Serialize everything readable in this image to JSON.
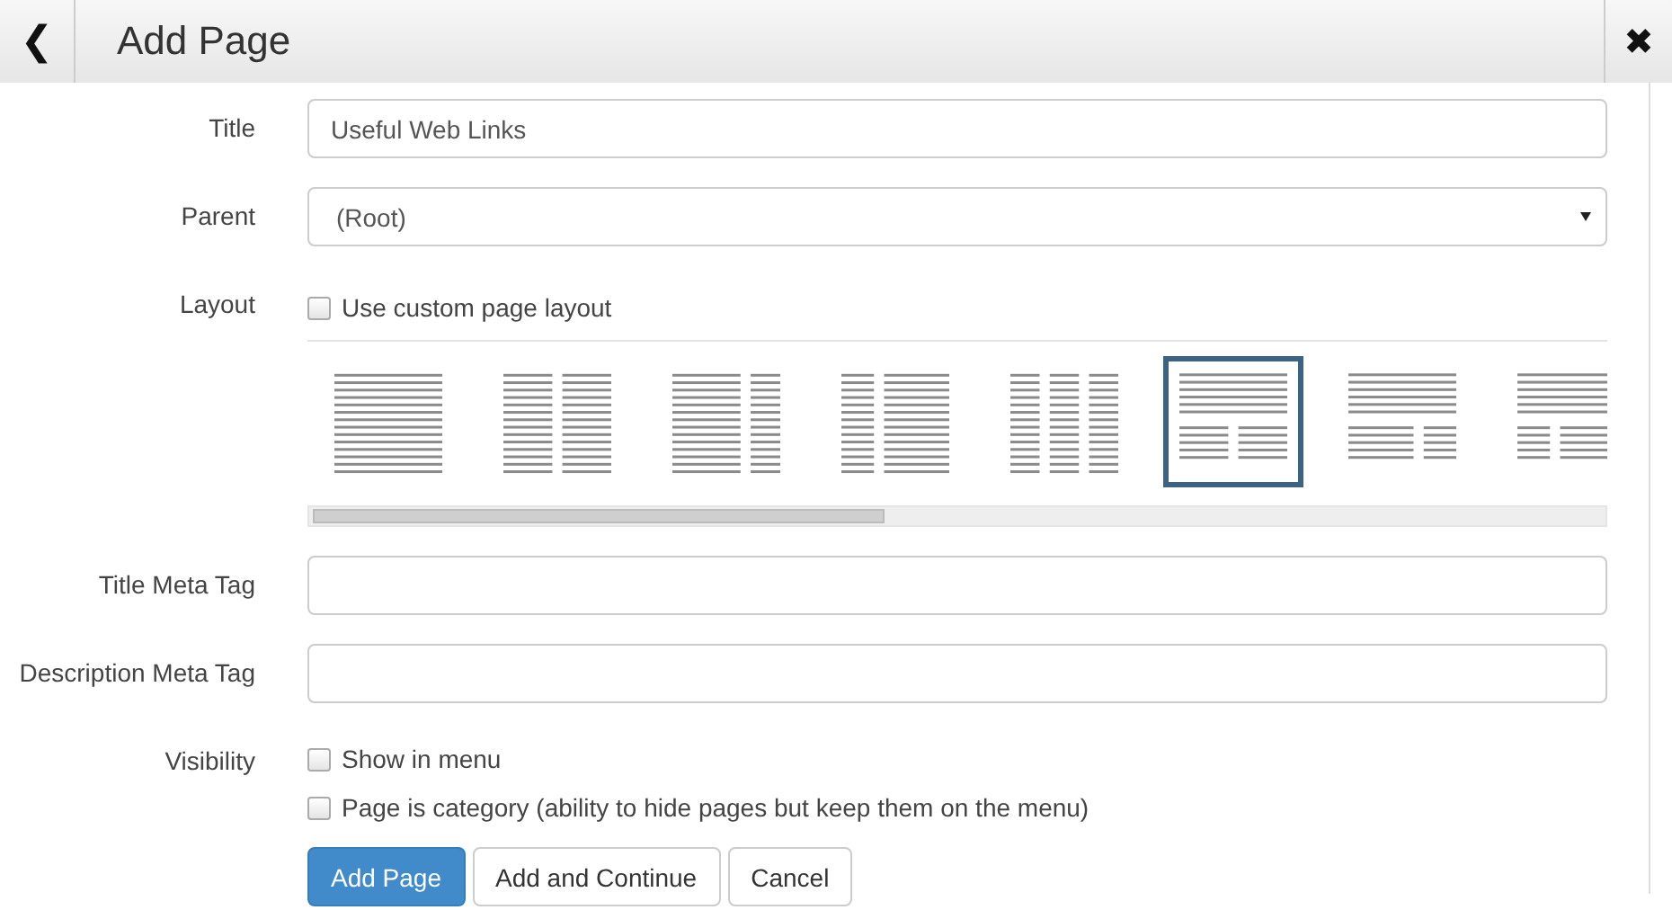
{
  "header": {
    "back": "❮",
    "title": "Add Page",
    "close": "✖"
  },
  "title_field": {
    "label": "Title",
    "value": "Useful Web Links"
  },
  "parent_field": {
    "label": "Parent",
    "value": "(Root)"
  },
  "layout": {
    "label": "Layout",
    "custom_checkbox": {
      "label": "Use custom page layout",
      "checked": false
    },
    "options": [
      {
        "kind": "one",
        "selected": false
      },
      {
        "kind": "two-equal",
        "selected": false
      },
      {
        "kind": "wide-narrow",
        "selected": false
      },
      {
        "kind": "narrow-wide",
        "selected": false
      },
      {
        "kind": "three",
        "selected": false
      },
      {
        "kind": "top-two-equal",
        "selected": true
      },
      {
        "kind": "top-wide-narrow",
        "selected": false
      },
      {
        "kind": "top-narrow-wide",
        "selected": false
      }
    ]
  },
  "title_meta": {
    "label": "Title Meta Tag"
  },
  "description_meta": {
    "label": "Description Meta Tag"
  },
  "visibility": {
    "label": "Visibility",
    "options": [
      {
        "label": "Show in menu",
        "checked": false
      },
      {
        "label": "Page is category (ability to hide pages but keep them on the menu)",
        "checked": false
      }
    ]
  },
  "buttons": [
    {
      "label": "Add Page",
      "kind": "primary"
    },
    {
      "label": "Add and Continue",
      "kind": "default"
    },
    {
      "label": "Cancel",
      "kind": "default"
    }
  ]
}
